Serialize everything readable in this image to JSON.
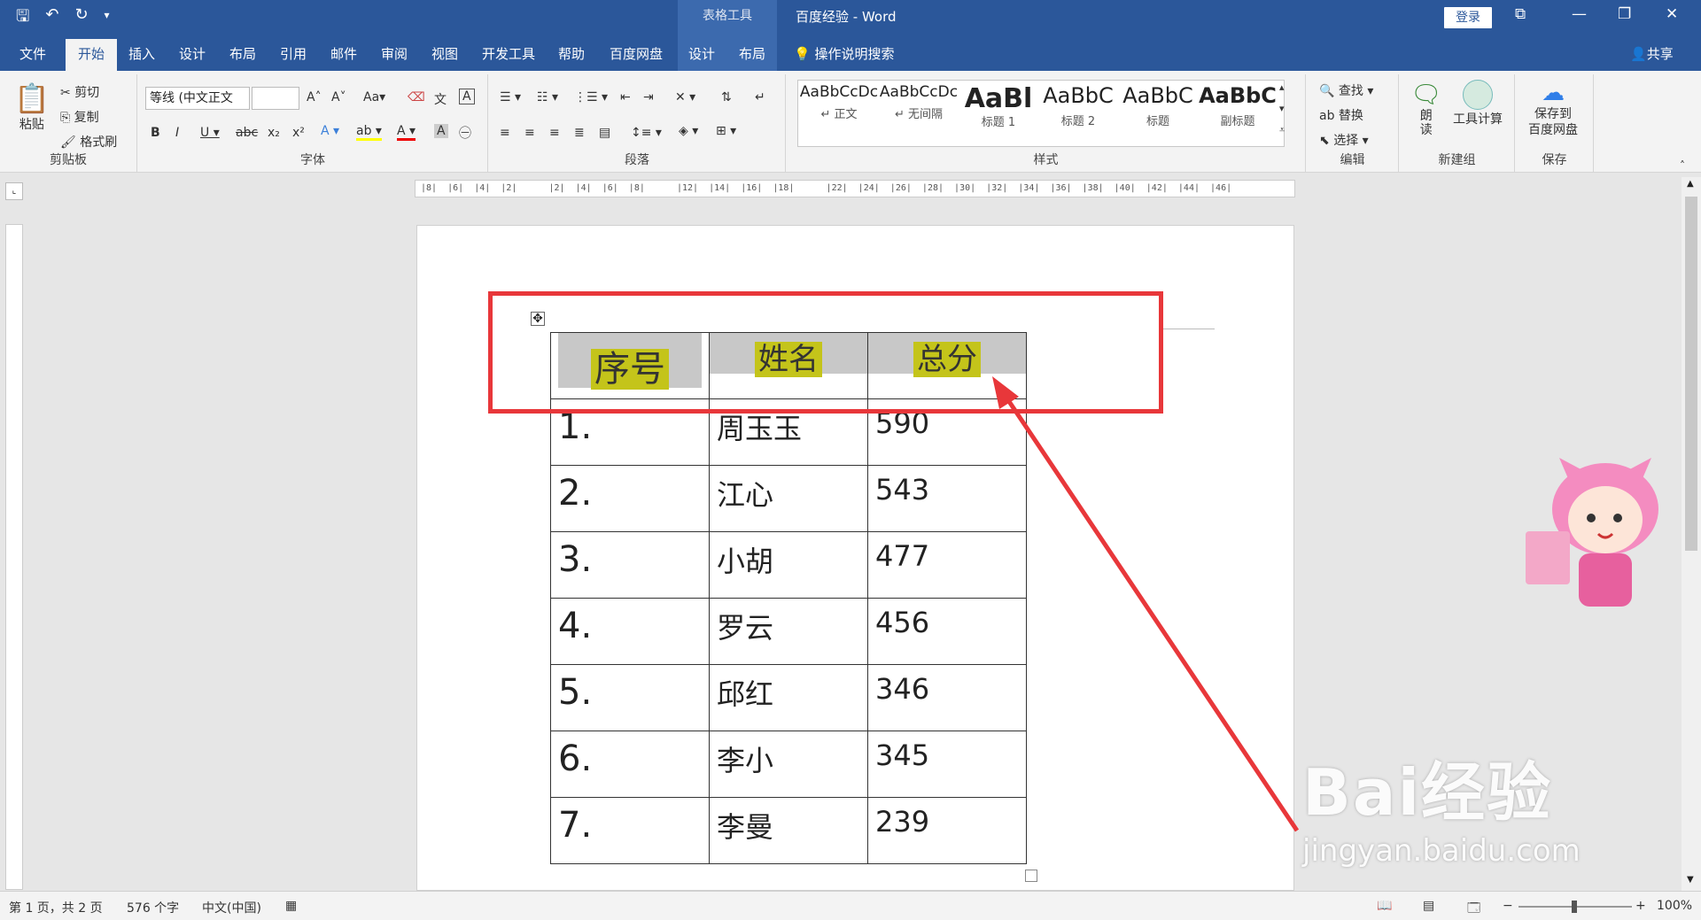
{
  "titlebar": {
    "context_tab": "表格工具",
    "doc_title": "百度经验  -  Word",
    "login": "登录"
  },
  "tabs": [
    {
      "label": "文件"
    },
    {
      "label": "开始"
    },
    {
      "label": "插入"
    },
    {
      "label": "设计"
    },
    {
      "label": "布局"
    },
    {
      "label": "引用"
    },
    {
      "label": "邮件"
    },
    {
      "label": "审阅"
    },
    {
      "label": "视图"
    },
    {
      "label": "开发工具"
    },
    {
      "label": "帮助"
    },
    {
      "label": "百度网盘"
    },
    {
      "label": "设计"
    },
    {
      "label": "布局"
    }
  ],
  "help_search": "操作说明搜索",
  "share": "共享",
  "ribbon": {
    "clipboard": {
      "paste": "粘贴",
      "cut": "剪切",
      "copy": "复制",
      "format_painter": "格式刷",
      "label": "剪贴板"
    },
    "font": {
      "font_name": "等线 (中文正文",
      "font_size": "",
      "label": "字体"
    },
    "paragraph": {
      "label": "段落"
    },
    "styles": {
      "items": [
        {
          "sample": "AaBbCcDc",
          "name": "↵ 正文"
        },
        {
          "sample": "AaBbCcDc",
          "name": "↵ 无间隔"
        },
        {
          "sample": "AaBl",
          "name": "标题 1"
        },
        {
          "sample": "AaBbC",
          "name": "标题 2"
        },
        {
          "sample": "AaBbC",
          "name": "标题"
        },
        {
          "sample": "AaBbC",
          "name": "副标题"
        }
      ],
      "label": "样式"
    },
    "editing": {
      "find": "查找",
      "replace": "替换",
      "select": "选择",
      "label": "编辑"
    },
    "new_group": {
      "read_aloud": "朗\n读",
      "tool_calc": "工具计算",
      "label": "新建组"
    },
    "save": {
      "save_to_baidu": "保存到\n百度网盘",
      "label": "保存"
    }
  },
  "ruler_marks": "|8|  |6|  |4|  |2|      |2|  |4|  |6|  |8|      |12|  |14|  |16|  |18|      |22|  |24|  |26|  |28|  |30|  |32|  |34|  |36|  |38|  |40|  |42|  |44|  |46|",
  "table": {
    "headers": [
      "序号",
      "姓名",
      "总分"
    ],
    "rows": [
      [
        "1.",
        "周玉玉",
        "590"
      ],
      [
        "2.",
        "江心",
        "543"
      ],
      [
        "3.",
        "小胡",
        "477"
      ],
      [
        "4.",
        "罗云",
        "456"
      ],
      [
        "5.",
        "邱红",
        "346"
      ],
      [
        "6.",
        "李小",
        "345"
      ],
      [
        "7.",
        "李曼",
        "239"
      ]
    ]
  },
  "statusbar": {
    "page": "第 1 页，共 2 页",
    "words": "576 个字",
    "language": "中文(中国)",
    "zoom": "100%"
  },
  "watermark": {
    "logo": "Bai经验",
    "url": "jingyan.baidu.com"
  },
  "colors": {
    "primary": "#2b579a",
    "highlight": "#e8373a",
    "header_fill": "#c8c8c8",
    "text_highlight": "#c4c41a"
  }
}
